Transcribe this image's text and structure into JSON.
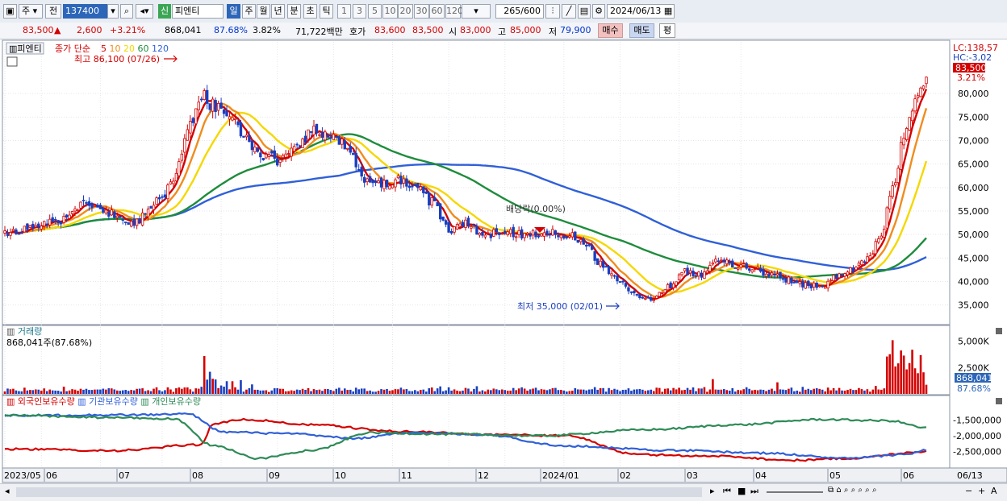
{
  "toolbar": {
    "market": "주",
    "scope": "전",
    "code": "137400",
    "badge": "신",
    "name": "피엔티",
    "periods": [
      "일",
      "주",
      "월",
      "년",
      "분",
      "초",
      "틱"
    ],
    "selected_period": "일",
    "intervals": [
      "1",
      "3",
      "5",
      "10",
      "20",
      "30",
      "60",
      "120"
    ],
    "count": "265",
    "count_max": "/600",
    "date": "2024/06/13"
  },
  "quote": {
    "price": "83,500",
    "change": "2,600",
    "change_pct": "+3.21%",
    "volume": "868,041",
    "volume_ratio": "87.68%",
    "turnover_pct": "3.82%",
    "amount": "71,722백만",
    "ask_label": "호가",
    "ask1": "83,600",
    "bid1": "83,500",
    "open_label": "시",
    "open": "83,000",
    "high_label": "고",
    "high": "85,000",
    "low_label": "저",
    "low": "79,900",
    "buy": "매수",
    "sell": "매도",
    "avg": "평"
  },
  "price_panel": {
    "tab": "피엔티",
    "legend_title": "종가 단순",
    "ma_periods": [
      "5",
      "10",
      "20",
      "60",
      "120"
    ],
    "ma_colors": [
      "#d40000",
      "#f08c1e",
      "#f5d800",
      "#1e8c3c",
      "#3060d8"
    ],
    "high_note": "최고 86,100 (07/26)",
    "low_note": "최저 35,000 (02/01)",
    "dividend_note": "배당락(0.00%)",
    "lc_label": "LC:138,57",
    "hc_label": "HC:-3,02",
    "price_tag": "83,500",
    "pct_tag": "3.21%"
  },
  "volume_panel": {
    "title": "거래량",
    "value": "868,041주(87.68%)",
    "tag_value": "868,041",
    "tag_pct": "87.68%"
  },
  "holding_panel": {
    "series_labels": [
      "외국인보유수량",
      "기관보유수량",
      "개인보유수량"
    ],
    "colors": [
      "#d40000",
      "#3060d8",
      "#2e8b57"
    ]
  },
  "x_labels": [
    "2023/05",
    "06",
    "07",
    "08",
    "09",
    "10",
    "11",
    "12",
    "2024/01",
    "02",
    "03",
    "04",
    "05",
    "06"
  ],
  "end_date_label": "06/13",
  "chart_data": {
    "type": "candlestick",
    "price_axis": {
      "ticks": [
        35000,
        40000,
        45000,
        50000,
        55000,
        60000,
        65000,
        70000,
        75000,
        80000
      ],
      "tick_labels": [
        "35,000",
        "40,000",
        "45,000",
        "50,000",
        "55,000",
        "60,000",
        "65,000",
        "70,000",
        "75,000",
        "80,000"
      ],
      "ylim": [
        31000,
        91000
      ]
    },
    "close_waypoints": [
      [
        0,
        50000
      ],
      [
        10,
        51500
      ],
      [
        20,
        53000
      ],
      [
        28,
        56500
      ],
      [
        35,
        55000
      ],
      [
        45,
        52000
      ],
      [
        55,
        57000
      ],
      [
        60,
        62000
      ],
      [
        66,
        74000
      ],
      [
        70,
        80000
      ],
      [
        74,
        77500
      ],
      [
        80,
        76000
      ],
      [
        86,
        70000
      ],
      [
        92,
        67000
      ],
      [
        98,
        65500
      ],
      [
        104,
        69000
      ],
      [
        110,
        72000
      ],
      [
        116,
        71000
      ],
      [
        122,
        69000
      ],
      [
        128,
        62000
      ],
      [
        134,
        60500
      ],
      [
        140,
        61500
      ],
      [
        146,
        60500
      ],
      [
        152,
        57000
      ],
      [
        158,
        51000
      ],
      [
        164,
        52500
      ],
      [
        170,
        50000
      ],
      [
        178,
        50500
      ],
      [
        186,
        50000
      ],
      [
        194,
        50500
      ],
      [
        200,
        50000
      ],
      [
        206,
        48500
      ],
      [
        212,
        44000
      ],
      [
        218,
        40500
      ],
      [
        224,
        37500
      ],
      [
        230,
        36000
      ],
      [
        236,
        39000
      ],
      [
        242,
        42000
      ],
      [
        248,
        41500
      ],
      [
        254,
        44500
      ],
      [
        260,
        43500
      ],
      [
        266,
        43000
      ],
      [
        272,
        41500
      ],
      [
        278,
        40500
      ],
      [
        284,
        39500
      ],
      [
        290,
        39000
      ],
      [
        296,
        41000
      ],
      [
        302,
        42500
      ],
      [
        308,
        45500
      ],
      [
        312,
        50000
      ],
      [
        316,
        60000
      ],
      [
        320,
        70000
      ],
      [
        324,
        79000
      ],
      [
        328,
        83500
      ]
    ],
    "n_sessions": 329,
    "volume_axis": {
      "ticks": [
        2500,
        5000
      ],
      "tick_labels": [
        "2,500K",
        "5,000K"
      ],
      "ylim": [
        0,
        6200
      ]
    },
    "holding_axis": {
      "ticks": [
        -2500000,
        -2000000,
        -1500000
      ],
      "tick_labels": [
        "-2,500,000",
        "-2,000,000",
        "-1,500,000"
      ],
      "ylim": [
        -3000000,
        -1100000
      ]
    },
    "series": [
      {
        "name": "외국인보유수량",
        "waypoints": [
          [
            0,
            -2420000
          ],
          [
            40,
            -2470000
          ],
          [
            70,
            -2280000
          ],
          [
            74,
            -1620000
          ],
          [
            85,
            -1480000
          ],
          [
            110,
            -1650000
          ],
          [
            140,
            -1860000
          ],
          [
            175,
            -1960000
          ],
          [
            200,
            -2000000
          ],
          [
            225,
            -2600000
          ],
          [
            255,
            -2650000
          ],
          [
            280,
            -2780000
          ],
          [
            300,
            -2720000
          ],
          [
            328,
            -2500000
          ]
        ]
      },
      {
        "name": "기관보유수량",
        "waypoints": [
          [
            0,
            -1350000
          ],
          [
            50,
            -1330000
          ],
          [
            65,
            -1300000
          ],
          [
            78,
            -1880000
          ],
          [
            100,
            -1930000
          ],
          [
            125,
            -2080000
          ],
          [
            145,
            -1900000
          ],
          [
            170,
            -1960000
          ],
          [
            200,
            -2330000
          ],
          [
            240,
            -2470000
          ],
          [
            270,
            -2550000
          ],
          [
            300,
            -2720000
          ],
          [
            320,
            -2600000
          ],
          [
            328,
            -2450000
          ]
        ]
      },
      {
        "name": "개인보유수량",
        "waypoints": [
          [
            0,
            -1350000
          ],
          [
            40,
            -1420000
          ],
          [
            60,
            -1460000
          ],
          [
            74,
            -2300000
          ],
          [
            90,
            -2720000
          ],
          [
            110,
            -2450000
          ],
          [
            130,
            -1900000
          ],
          [
            160,
            -1950000
          ],
          [
            190,
            -2000000
          ],
          [
            230,
            -1800000
          ],
          [
            260,
            -1650000
          ],
          [
            290,
            -1480000
          ],
          [
            315,
            -1520000
          ],
          [
            328,
            -1750000
          ]
        ]
      }
    ]
  }
}
